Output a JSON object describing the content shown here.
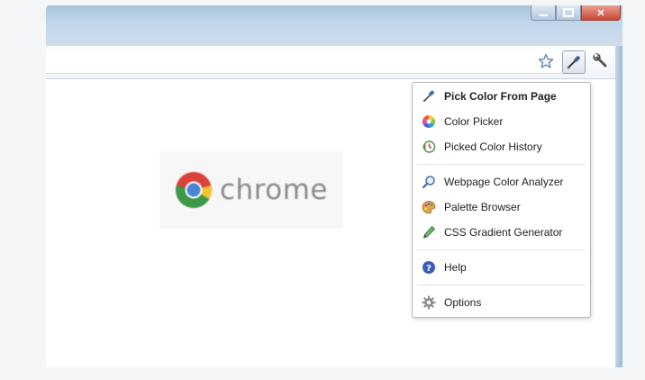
{
  "window": {
    "controls": [
      "minimize",
      "maximize",
      "close"
    ],
    "close_glyph": "✕"
  },
  "toolbar": {
    "icons": [
      "star-icon",
      "eyedropper-icon",
      "wrench-icon"
    ]
  },
  "content": {
    "logo_text": "chrome"
  },
  "menu": {
    "items": [
      {
        "label": "Pick Color From Page",
        "icon": "eyedropper-icon",
        "bold": true
      },
      {
        "label": "Color Picker",
        "icon": "color-wheel-icon"
      },
      {
        "label": "Picked Color History",
        "icon": "history-icon"
      },
      {
        "label": "Webpage Color Analyzer",
        "icon": "magnifier-icon"
      },
      {
        "label": "Palette Browser",
        "icon": "palette-icon"
      },
      {
        "label": "CSS Gradient Generator",
        "icon": "pen-icon"
      },
      {
        "label": "Help",
        "icon": "help-icon"
      },
      {
        "label": "Options",
        "icon": "gear-icon"
      }
    ]
  },
  "colors": {
    "titlebar": "#a9c2dc",
    "close_button": "#c64a35",
    "menu_border": "#b8b8b8"
  }
}
